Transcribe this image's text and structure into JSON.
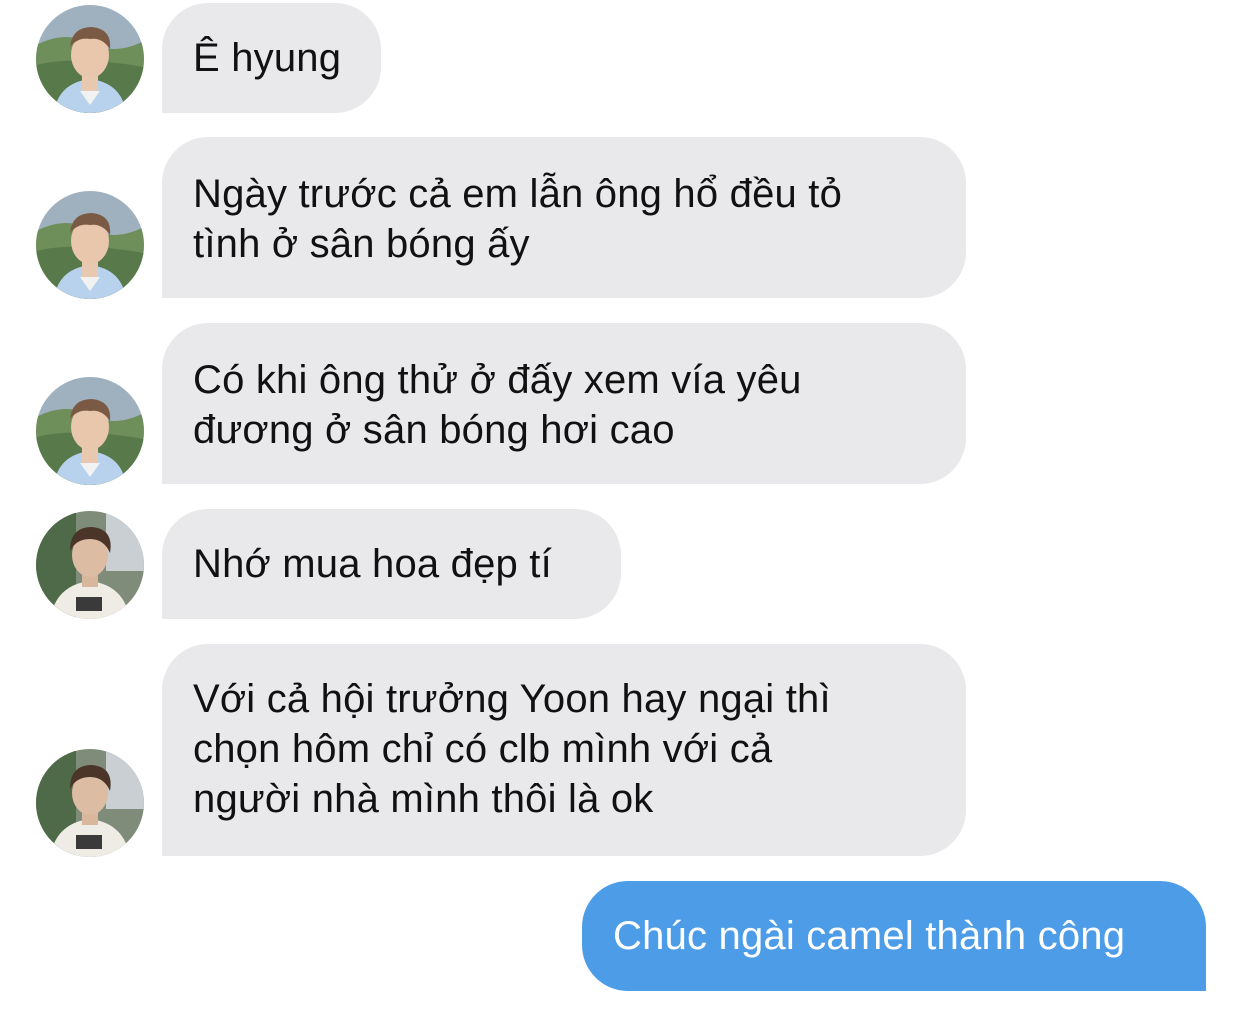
{
  "conversation": {
    "messages": [
      {
        "sender": "incoming",
        "avatar": "avatar-a",
        "text": "Ê hyung"
      },
      {
        "sender": "incoming",
        "avatar": "avatar-a",
        "text": "Ngày trước cả em lẫn ông hổ đều tỏ\ntình ở sân bóng ấy"
      },
      {
        "sender": "incoming",
        "avatar": "avatar-a",
        "text": "Có khi ông thử ở đấy xem vía yêu\nđương ở sân bóng hơi cao"
      },
      {
        "sender": "incoming",
        "avatar": "avatar-b",
        "text": "Nhớ mua hoa đẹp tí"
      },
      {
        "sender": "incoming",
        "avatar": "avatar-b",
        "text": "Với cả hội trưởng Yoon hay ngại thì\nchọn hôm chỉ có clb mình với cả\nngười nhà mình thôi là ok"
      },
      {
        "sender": "outgoing",
        "text": "Chúc ngài camel thành công"
      }
    ]
  },
  "colors": {
    "incoming_bubble": "#e9e9eb",
    "outgoing_bubble": "#4d9ce8",
    "incoming_text": "#111111",
    "outgoing_text": "#ffffff"
  }
}
